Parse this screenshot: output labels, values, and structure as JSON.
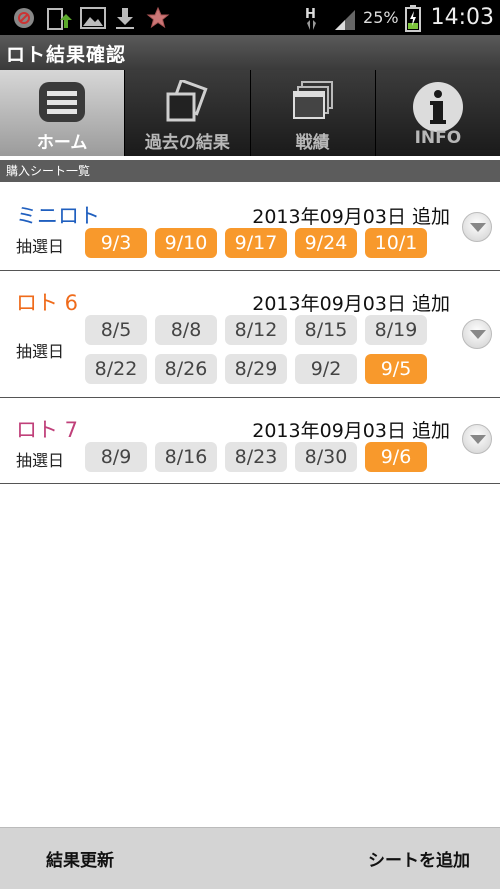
{
  "status_bar": {
    "network": "H",
    "battery": "25%",
    "clock": "14:03",
    "icons": [
      "blocked-app-icon",
      "sync-icon",
      "image-icon",
      "download-icon",
      "star-icon"
    ]
  },
  "app": {
    "title": "ロト結果確認"
  },
  "tabs": [
    {
      "label": "ホーム",
      "icon": "home-list-icon",
      "active": true
    },
    {
      "label": "過去の結果",
      "icon": "past-results-icon",
      "active": false
    },
    {
      "label": "戦績",
      "icon": "record-icon",
      "active": false
    },
    {
      "label": "INFO",
      "icon": "info-icon",
      "active": false
    }
  ],
  "section": {
    "title": "購入シート一覧"
  },
  "sheets": [
    {
      "name": "ミニロト",
      "name_color": "#1f5fbf",
      "date": "2013年09月03日 追加",
      "label": "抽選日",
      "draws": [
        {
          "date": "9/3",
          "win": true
        },
        {
          "date": "9/10",
          "win": true
        },
        {
          "date": "9/17",
          "win": true
        },
        {
          "date": "9/24",
          "win": true
        },
        {
          "date": "10/1",
          "win": true
        }
      ]
    },
    {
      "name": "ロト 6",
      "name_color": "#ef6b1b",
      "date": "2013年09月03日 追加",
      "label": "抽選日",
      "draws": [
        {
          "date": "8/5",
          "win": false
        },
        {
          "date": "8/8",
          "win": false
        },
        {
          "date": "8/12",
          "win": false
        },
        {
          "date": "8/15",
          "win": false
        },
        {
          "date": "8/19",
          "win": false
        },
        {
          "date": "8/22",
          "win": false
        },
        {
          "date": "8/26",
          "win": false
        },
        {
          "date": "8/29",
          "win": false
        },
        {
          "date": "9/2",
          "win": false
        },
        {
          "date": "9/5",
          "win": true
        }
      ]
    },
    {
      "name": "ロト 7",
      "name_color": "#c0407a",
      "date": "2013年09月03日 追加",
      "label": "抽選日",
      "draws": [
        {
          "date": "8/9",
          "win": false
        },
        {
          "date": "8/16",
          "win": false
        },
        {
          "date": "8/23",
          "win": false
        },
        {
          "date": "8/30",
          "win": false
        },
        {
          "date": "9/6",
          "win": true
        }
      ]
    }
  ],
  "bottom": {
    "refresh": "結果更新",
    "add_sheet": "シートを追加"
  }
}
